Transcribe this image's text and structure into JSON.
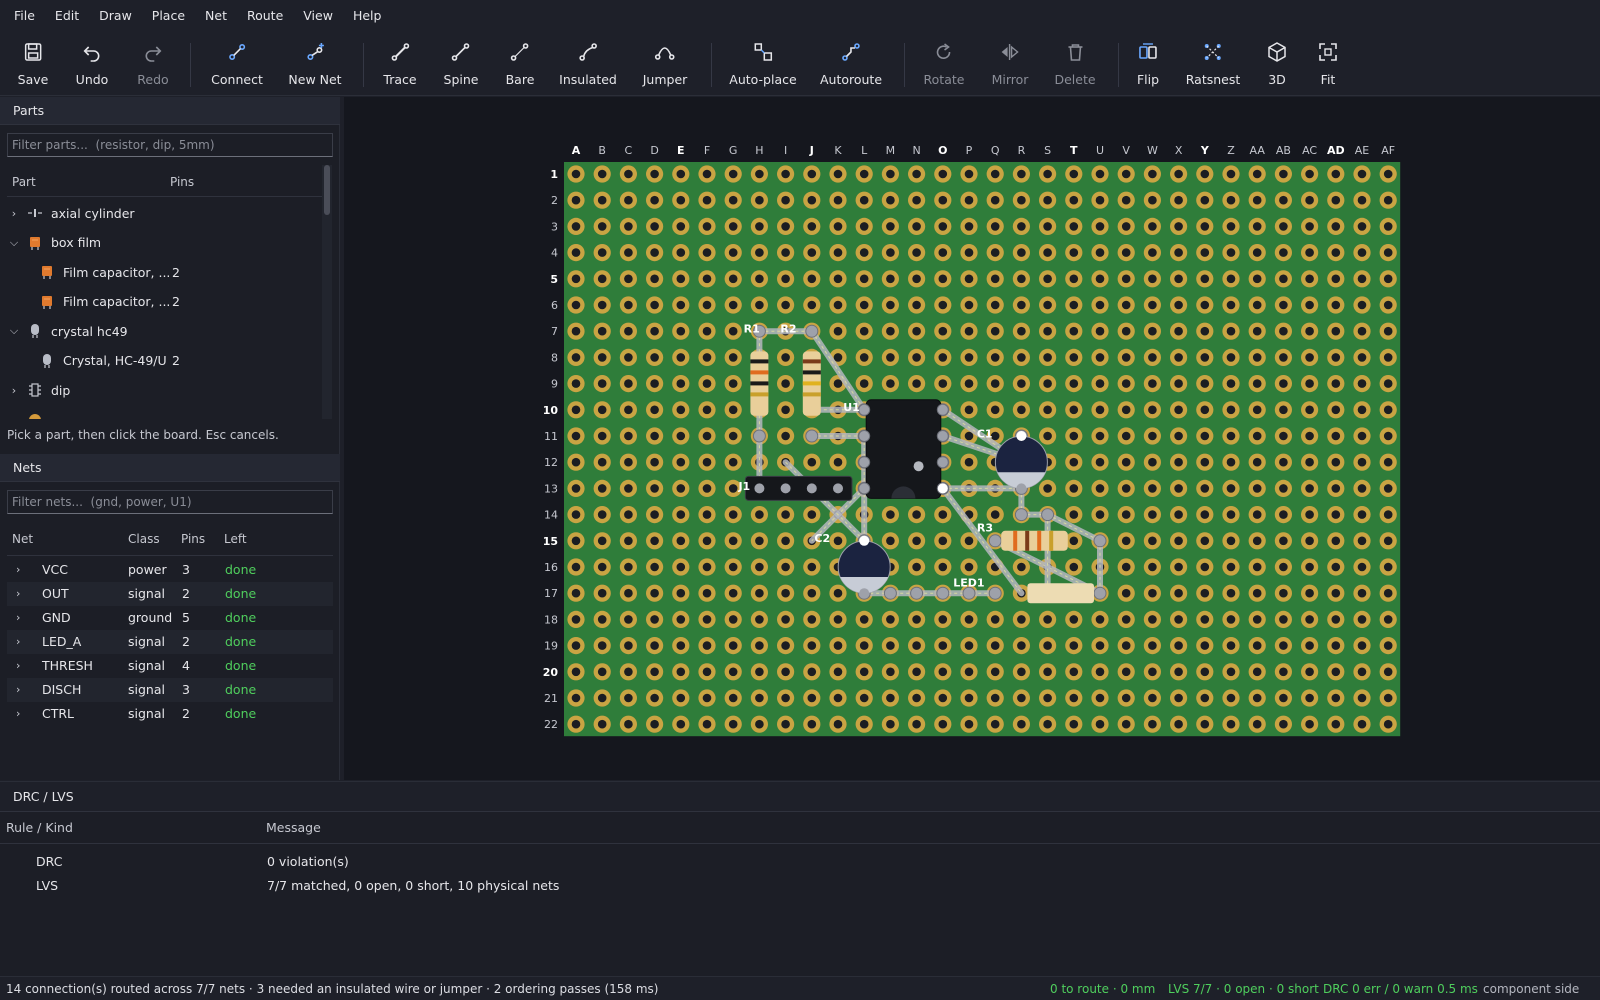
{
  "menu": [
    "File",
    "Edit",
    "Draw",
    "Place",
    "Net",
    "Route",
    "View",
    "Help"
  ],
  "toolbar": [
    {
      "label": "Save",
      "icon": "save-icon",
      "enabled": true
    },
    {
      "label": "Undo",
      "icon": "undo-icon",
      "enabled": true
    },
    {
      "label": "Redo",
      "icon": "redo-icon",
      "enabled": false
    },
    {
      "label": "Connect",
      "icon": "connect-icon",
      "enabled": true
    },
    {
      "label": "New Net",
      "icon": "new-net-icon",
      "enabled": true
    },
    {
      "label": "Trace",
      "icon": "trace-icon",
      "enabled": true
    },
    {
      "label": "Spine",
      "icon": "spine-icon",
      "enabled": true
    },
    {
      "label": "Bare",
      "icon": "bare-wire-icon",
      "enabled": true
    },
    {
      "label": "Insulated",
      "icon": "insulated-wire-icon",
      "enabled": true
    },
    {
      "label": "Jumper",
      "icon": "jumper-icon",
      "enabled": true
    },
    {
      "label": "Auto-place",
      "icon": "auto-place-icon",
      "enabled": true
    },
    {
      "label": "Autoroute",
      "icon": "autoroute-icon",
      "enabled": true
    },
    {
      "label": "Rotate",
      "icon": "rotate-icon",
      "enabled": false
    },
    {
      "label": "Mirror",
      "icon": "mirror-icon",
      "enabled": false
    },
    {
      "label": "Delete",
      "icon": "trash-icon",
      "enabled": false
    },
    {
      "label": "Flip",
      "icon": "flip-icon",
      "enabled": true
    },
    {
      "label": "Ratsnest",
      "icon": "ratsnest-icon",
      "enabled": true
    },
    {
      "label": "3D",
      "icon": "cube-icon",
      "enabled": true
    },
    {
      "label": "Fit",
      "icon": "fit-icon",
      "enabled": true
    }
  ],
  "parts": {
    "title": "Parts",
    "filter_placeholder": "Filter parts...  (resistor, dip, 5mm)",
    "col_part": "Part",
    "col_pins": "Pins",
    "tree": [
      {
        "label": "axial cylinder",
        "expanded": false,
        "level": 0,
        "pins": ""
      },
      {
        "label": "box film",
        "expanded": true,
        "level": 0,
        "pins": ""
      },
      {
        "label": "Film capacitor, ...",
        "level": 1,
        "pins": "2"
      },
      {
        "label": "Film capacitor, ...",
        "level": 1,
        "pins": "2"
      },
      {
        "label": "crystal hc49",
        "expanded": true,
        "level": 0,
        "pins": ""
      },
      {
        "label": "Crystal, HC-49/U",
        "level": 1,
        "pins": "2"
      },
      {
        "label": "dip",
        "expanded": false,
        "level": 0,
        "pins": ""
      }
    ],
    "hint": "Pick a part, then click the board. Esc cancels."
  },
  "nets": {
    "title": "Nets",
    "filter_placeholder": "Filter nets...  (gnd, power, U1)",
    "columns": [
      "Net",
      "Class",
      "Pins",
      "Left"
    ],
    "rows": [
      {
        "net": "VCC",
        "class": "power",
        "pins": "3",
        "left": "done"
      },
      {
        "net": "OUT",
        "class": "signal",
        "pins": "2",
        "left": "done"
      },
      {
        "net": "GND",
        "class": "ground",
        "pins": "5",
        "left": "done"
      },
      {
        "net": "LED_A",
        "class": "signal",
        "pins": "2",
        "left": "done"
      },
      {
        "net": "THRESH",
        "class": "signal",
        "pins": "4",
        "left": "done"
      },
      {
        "net": "DISCH",
        "class": "signal",
        "pins": "3",
        "left": "done"
      },
      {
        "net": "CTRL",
        "class": "signal",
        "pins": "2",
        "left": "done"
      }
    ]
  },
  "board": {
    "columns": [
      "A",
      "B",
      "C",
      "D",
      "E",
      "F",
      "G",
      "H",
      "I",
      "J",
      "K",
      "L",
      "M",
      "N",
      "O",
      "P",
      "Q",
      "R",
      "S",
      "T",
      "U",
      "V",
      "W",
      "X",
      "Y",
      "Z",
      "AA",
      "AB",
      "AC",
      "AD",
      "AE",
      "AF"
    ],
    "bold_columns": [
      "A",
      "E",
      "J",
      "O",
      "T",
      "Y",
      "AD"
    ],
    "rows": 22,
    "bold_rows": [
      1,
      5,
      10,
      15,
      20
    ],
    "board_color": "#2f7d3a",
    "pad_color": "#c9a443",
    "refdes": [
      "R1",
      "R2",
      "U1",
      "C1",
      "J1",
      "C2",
      "R3",
      "LED1"
    ]
  },
  "drc": {
    "title": "DRC / LVS",
    "col_rule": "Rule / Kind",
    "col_message": "Message",
    "rows": [
      {
        "rule": "DRC",
        "message": "0 violation(s)"
      },
      {
        "rule": "LVS",
        "message": "7/7 matched, 0 open, 0 short, 10 physical nets"
      }
    ]
  },
  "status": {
    "main": "14 connection(s) routed across 7/7 nets · 3 needed an insulated wire or jumper · 2 ordering passes  (158 ms)",
    "route": "0 to route · 0 mm",
    "lvs": "LVS 7/7 · 0 open · 0 short",
    "drc": "DRC 0 err / 0 warn 0.5 ms",
    "side": "component side"
  }
}
